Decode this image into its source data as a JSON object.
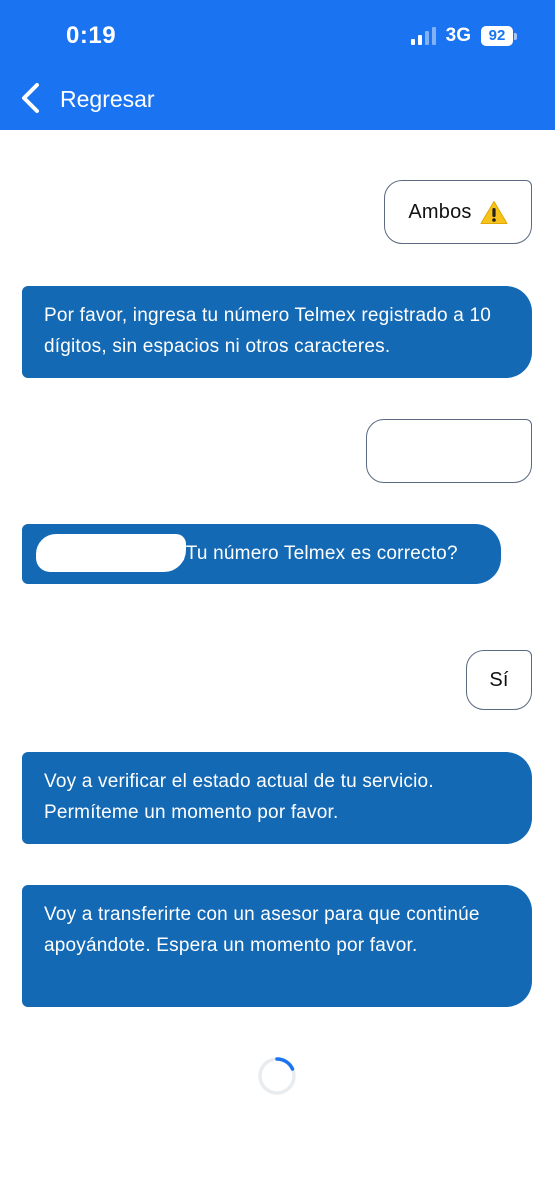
{
  "status_bar": {
    "time": "0:19",
    "network": "3G",
    "battery": "92"
  },
  "nav": {
    "back_label": "Regresar",
    "back_icon": "chevron-left-icon"
  },
  "colors": {
    "header_blue": "#1a73f0",
    "bot_bubble": "#1469b4",
    "user_border": "#5a6a80"
  },
  "messages": [
    {
      "from": "user",
      "text": "Ambos",
      "icon": "warning-icon"
    },
    {
      "from": "bot",
      "text": "Por favor, ingresa tu número Telmex registrado a 10 dígitos, sin espacios ni otros caracteres."
    },
    {
      "from": "user",
      "text": ""
    },
    {
      "from": "bot",
      "text": "¿Tu número Telmex es correcto?"
    },
    {
      "from": "user",
      "text": "Sí"
    },
    {
      "from": "bot",
      "text": "Voy a verificar el estado actual de tu servicio. Permíteme un momento por favor."
    },
    {
      "from": "bot",
      "text": "Voy a transferirte con un asesor para que continúe apoyándote. Espera un momento por favor."
    }
  ],
  "loading": {
    "icon": "loading-spinner-icon"
  }
}
